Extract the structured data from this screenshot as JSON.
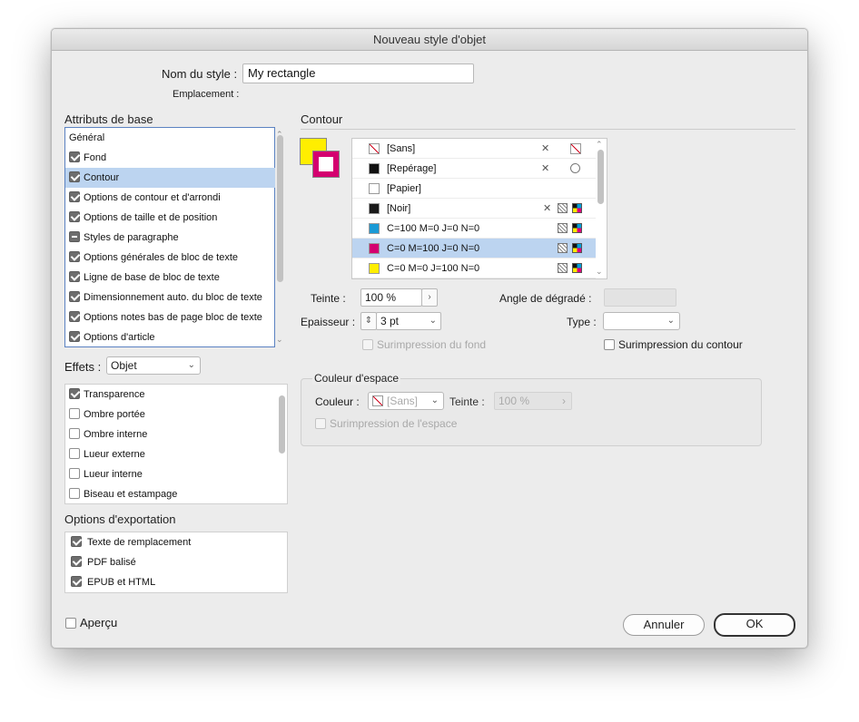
{
  "window": {
    "title": "Nouveau style d'objet"
  },
  "style": {
    "name_label": "Nom du style :",
    "name_value": "My rectangle",
    "location_label": "Emplacement :"
  },
  "basic": {
    "title": "Attributs de base",
    "items": [
      {
        "label": "Général",
        "check": "none",
        "selected": false
      },
      {
        "label": "Fond",
        "check": "on",
        "selected": false
      },
      {
        "label": "Contour",
        "check": "on",
        "selected": true
      },
      {
        "label": "Options de contour et d'arrondi",
        "check": "on",
        "selected": false
      },
      {
        "label": "Options de taille et de position",
        "check": "on",
        "selected": false
      },
      {
        "label": "Styles de paragraphe",
        "check": "mixed",
        "selected": false
      },
      {
        "label": "Options générales de bloc de texte",
        "check": "on",
        "selected": false
      },
      {
        "label": "Ligne de base de bloc de texte",
        "check": "on",
        "selected": false
      },
      {
        "label": "Dimensionnement auto. du bloc de texte",
        "check": "on",
        "selected": false
      },
      {
        "label": "Options notes bas de page bloc de texte",
        "check": "on",
        "selected": false
      },
      {
        "label": "Options d'article",
        "check": "on",
        "selected": false
      }
    ]
  },
  "effects": {
    "label": "Effets :",
    "dropdown": "Objet",
    "items": [
      {
        "label": "Transparence",
        "check": "on"
      },
      {
        "label": "Ombre portée",
        "check": "off"
      },
      {
        "label": "Ombre interne",
        "check": "off"
      },
      {
        "label": "Lueur externe",
        "check": "off"
      },
      {
        "label": "Lueur interne",
        "check": "off"
      },
      {
        "label": "Biseau et estampage",
        "check": "off"
      }
    ]
  },
  "export": {
    "title": "Options d'exportation",
    "items": [
      {
        "label": "Texte de remplacement",
        "check": "on"
      },
      {
        "label": "PDF balisé",
        "check": "on"
      },
      {
        "label": "EPUB et HTML",
        "check": "on"
      }
    ]
  },
  "preview": {
    "label": "Aperçu"
  },
  "contour": {
    "title": "Contour",
    "swatches": [
      {
        "name": "[Sans]",
        "color": "none",
        "icons": [
          "pencil",
          "none"
        ],
        "selected": false
      },
      {
        "name": "[Repérage]",
        "color": "#111111",
        "icons": [
          "pencil",
          "reg"
        ],
        "selected": false
      },
      {
        "name": "[Papier]",
        "color": "#ffffff",
        "icons": [],
        "selected": false
      },
      {
        "name": "[Noir]",
        "color": "#1a1a1a",
        "icons": [
          "pencil",
          "grid",
          "cmyk"
        ],
        "selected": false
      },
      {
        "name": "C=100 M=0 J=0 N=0",
        "color": "#1a9ad6",
        "icons": [
          "grid",
          "cmyk"
        ],
        "selected": false
      },
      {
        "name": "C=0 M=100 J=0 N=0",
        "color": "#d4006f",
        "icons": [
          "grid",
          "cmyk"
        ],
        "selected": true
      },
      {
        "name": "C=0 M=0 J=100 N=0",
        "color": "#ffee00",
        "icons": [
          "grid",
          "cmyk"
        ],
        "selected": false
      }
    ],
    "tint_label": "Teinte :",
    "tint_value": "100 %",
    "gradient_angle_label": "Angle de dégradé :",
    "weight_label": "Epaisseur :",
    "weight_value": "3 pt",
    "type_label": "Type :",
    "type_value": "",
    "overprint_fill": "Surimpression du fond",
    "overprint_stroke": "Surimpression du contour"
  },
  "gap": {
    "title": "Couleur d'espace",
    "color_label": "Couleur :",
    "color_value": "[Sans]",
    "tint_label": "Teinte :",
    "tint_value": "100 %",
    "overprint": "Surimpression de l'espace"
  },
  "buttons": {
    "cancel": "Annuler",
    "ok": "OK"
  },
  "colors": {
    "fill": "#ffee00",
    "stroke": "#d4006f",
    "selection": "#bcd4f0",
    "list_border": "#5b82c1"
  }
}
